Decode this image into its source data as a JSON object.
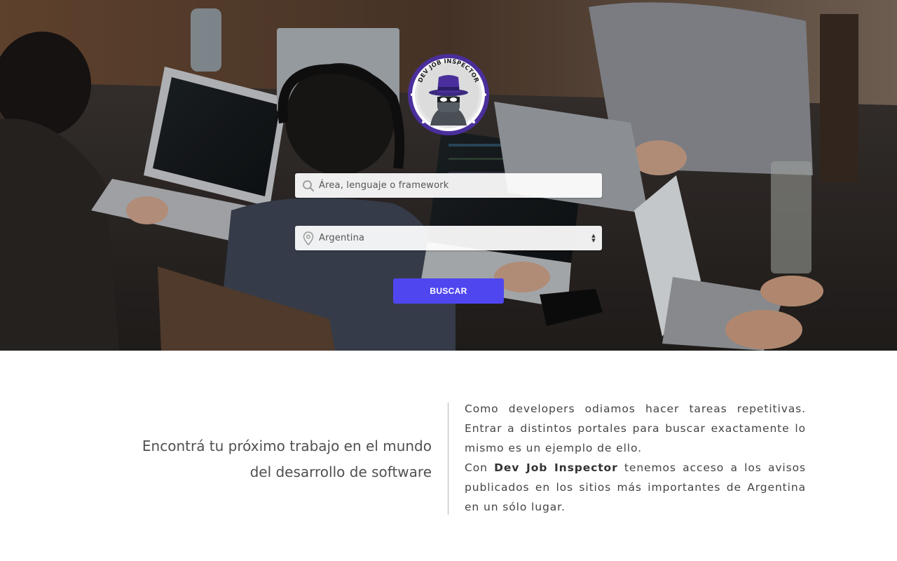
{
  "logo": {
    "text": "DEV JOB INSPECTOR",
    "icon": "spy-icon",
    "ring_color": "#4a2f9c"
  },
  "search": {
    "value": "Área, lenguaje o framework",
    "icon": "search-icon"
  },
  "location": {
    "value": "Argentina",
    "icon": "location-pin-icon"
  },
  "actions": {
    "search_label": "BUSCAR"
  },
  "tagline": {
    "line1": "Encontrá tu próximo trabajo en el mundo",
    "line2": "del desarrollo de software"
  },
  "description": {
    "p1": "Como developers odiamos hacer tareas repetitivas. Entrar a distintos portales para buscar exactamente lo mismo es un ejemplo de ello.",
    "p2_before": "Con",
    "p2_brand": "Dev Job Inspector",
    "p2_after": "tenemos acceso a los avisos publicados en los sitios más importantes de Argentina en un sólo lugar."
  },
  "colors": {
    "accent": "#5046ef",
    "text_dark": "#505050",
    "text_body": "#444444"
  }
}
